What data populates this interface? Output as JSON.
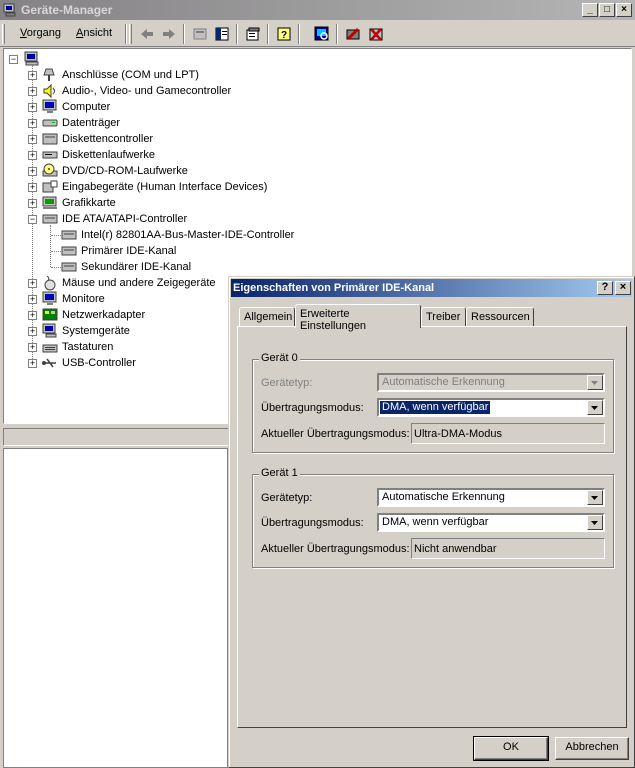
{
  "window": {
    "title": "Geräte-Manager",
    "caption_buttons": [
      "_",
      "□",
      "×"
    ]
  },
  "menu": {
    "items": [
      "Vorgang",
      "Ansicht"
    ]
  },
  "toolbar": {
    "icons": [
      "back-arrow-icon",
      "forward-arrow-icon",
      "device-list-icon",
      "console-tree-icon",
      "properties-icon",
      "help-icon",
      "scan-hardware-icon",
      "disable-device-icon",
      "uninstall-device-icon"
    ]
  },
  "tree": {
    "root": "computer-icon",
    "categories": [
      {
        "label": "Anschlüsse (COM und LPT)",
        "icon": "port-icon"
      },
      {
        "label": "Audio-, Video- und Gamecontroller",
        "icon": "speaker-icon"
      },
      {
        "label": "Computer",
        "icon": "monitor-icon"
      },
      {
        "label": "Datenträger",
        "icon": "disk-icon"
      },
      {
        "label": "Diskettencontroller",
        "icon": "floppy-controller-icon"
      },
      {
        "label": "Diskettenlaufwerke",
        "icon": "floppy-drive-icon"
      },
      {
        "label": "DVD/CD-ROM-Laufwerke",
        "icon": "cdrom-icon"
      },
      {
        "label": "Eingabegeräte (Human Interface Devices)",
        "icon": "hid-icon"
      },
      {
        "label": "Grafikkarte",
        "icon": "display-adapter-icon"
      },
      {
        "label": "IDE ATA/ATAPI-Controller",
        "icon": "ide-controller-icon",
        "expanded": true,
        "children": [
          "Intel(r) 82801AA-Bus-Master-IDE-Controller",
          "Primärer IDE-Kanal",
          "Sekundärer IDE-Kanal"
        ]
      },
      {
        "label": "Mäuse und andere Zeigegeräte",
        "icon": "mouse-icon"
      },
      {
        "label": "Monitore",
        "icon": "monitor-icon"
      },
      {
        "label": "Netzwerkadapter",
        "icon": "network-adapter-icon"
      },
      {
        "label": "Systemgeräte",
        "icon": "system-device-icon"
      },
      {
        "label": "Tastaturen",
        "icon": "keyboard-icon"
      },
      {
        "label": "USB-Controller",
        "icon": "usb-icon"
      }
    ]
  },
  "dialog": {
    "title": "Eigenschaften von Primärer IDE-Kanal",
    "help_button": "?",
    "close_button": "×",
    "tabs": [
      "Allgemein",
      "Erweiterte Einstellungen",
      "Treiber",
      "Ressourcen"
    ],
    "active_tab": "Erweiterte Einstellungen",
    "device0": {
      "group_title": "Gerät 0",
      "type_label": "Gerätetyp:",
      "type_value": "Automatische Erkennung",
      "mode_label": "Übertragungsmodus:",
      "mode_value": "DMA, wenn verfügbar",
      "current_label": "Aktueller Übertragungsmodus:",
      "current_value": "Ultra-DMA-Modus"
    },
    "device1": {
      "group_title": "Gerät 1",
      "type_label": "Gerätetyp:",
      "type_value": "Automatische Erkennung",
      "mode_label": "Übertragungsmodus:",
      "mode_value": "DMA, wenn verfügbar",
      "current_label": "Aktueller Übertragungsmodus:",
      "current_value": "Nicht anwendbar"
    },
    "ok_label": "OK",
    "cancel_label": "Abbrechen"
  },
  "colors": {
    "inactive_title": "#848284",
    "active_title": "#0a246a",
    "face": "#d4d0c8"
  }
}
